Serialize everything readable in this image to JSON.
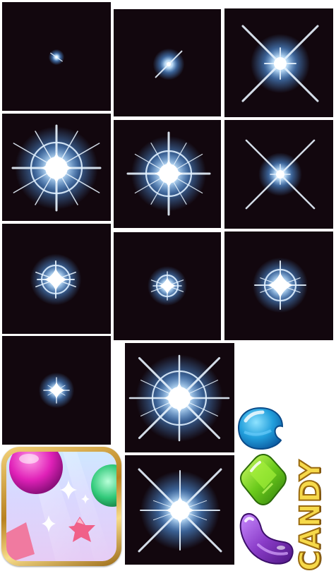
{
  "sheet": {
    "background": "#ffffff",
    "frame_background": "#12070e",
    "glow_color": "#5aa8ff",
    "core_color": "#ffffff"
  },
  "sparkle_frames": [
    {
      "id": "f1",
      "stage": "spark-tiny",
      "ring": false
    },
    {
      "id": "f2",
      "stage": "spark-small",
      "ring": false
    },
    {
      "id": "f3",
      "stage": "spark-cross-long",
      "ring": false
    },
    {
      "id": "f4",
      "stage": "burst-large",
      "ring": true
    },
    {
      "id": "f5",
      "stage": "burst-medium",
      "ring": true
    },
    {
      "id": "f6",
      "stage": "spark-cross",
      "ring": false
    },
    {
      "id": "f7",
      "stage": "star-ring",
      "ring": true
    },
    {
      "id": "f8",
      "stage": "star-ring-small",
      "ring": true
    },
    {
      "id": "f9",
      "stage": "star-ring",
      "ring": true
    },
    {
      "id": "f10",
      "stage": "star-small",
      "ring": false
    },
    {
      "id": "f11",
      "stage": "burst-large",
      "ring": true
    },
    {
      "id": "f12",
      "stage": "burst-cross",
      "ring": false
    }
  ],
  "game_icon": {
    "frame_color": "#d9a84a",
    "icon": "candy-game-icon"
  },
  "candies": [
    {
      "name": "blue-candy",
      "color": "#2aa6e0",
      "icon": "blue-round-candy-icon"
    },
    {
      "name": "green-candy",
      "color": "#6cc820",
      "icon": "green-diamond-candy-icon"
    },
    {
      "name": "purple-candy",
      "color": "#8a3cc8",
      "icon": "purple-bean-candy-icon"
    }
  ],
  "logo": {
    "text": "CANDY",
    "color": "#f6d94a"
  }
}
